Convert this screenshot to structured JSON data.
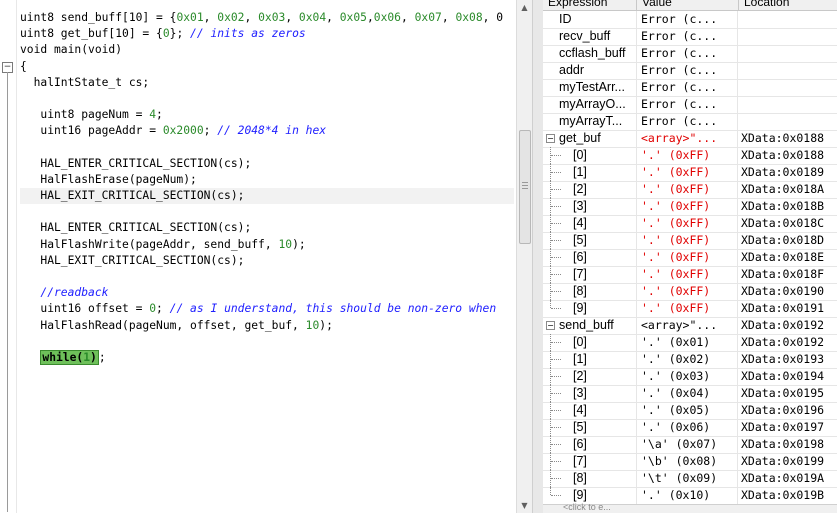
{
  "editor": {
    "fold_symbol": "−",
    "code_lines": [
      {
        "kind": "plain",
        "parts": [
          [
            "uint8 send_buff[10] = {",
            ""
          ],
          [
            "0x01",
            "num"
          ],
          [
            ", ",
            ""
          ],
          [
            "0x02",
            "num"
          ],
          [
            ", ",
            ""
          ],
          [
            "0x03",
            "num"
          ],
          [
            ", ",
            ""
          ],
          [
            "0x04",
            "num"
          ],
          [
            ", ",
            ""
          ],
          [
            "0x05",
            "num"
          ],
          [
            ",",
            ""
          ],
          [
            "0x06",
            "num"
          ],
          [
            ", ",
            ""
          ],
          [
            "0x07",
            "num"
          ],
          [
            ", ",
            ""
          ],
          [
            "0x08",
            "num"
          ],
          [
            ", 0",
            ""
          ]
        ]
      },
      {
        "kind": "plain",
        "parts": [
          [
            "uint8 get_buf[10] = {",
            ""
          ],
          [
            "0",
            "num"
          ],
          [
            "}; ",
            ""
          ],
          [
            "// inits as zeros",
            "cmt"
          ]
        ]
      },
      {
        "kind": "plain",
        "parts": [
          [
            "void main(void)",
            ""
          ]
        ]
      },
      {
        "kind": "plain",
        "parts": [
          [
            "{",
            ""
          ]
        ]
      },
      {
        "kind": "plain",
        "parts": [
          [
            "  halIntState_t cs;",
            ""
          ]
        ]
      },
      {
        "kind": "plain",
        "parts": [
          [
            "",
            ""
          ]
        ]
      },
      {
        "kind": "plain",
        "parts": [
          [
            "   uint8 pageNum = ",
            ""
          ],
          [
            "4",
            "num"
          ],
          [
            ";",
            ""
          ]
        ]
      },
      {
        "kind": "plain",
        "parts": [
          [
            "   uint16 pageAddr = ",
            ""
          ],
          [
            "0x2000",
            "num"
          ],
          [
            "; ",
            ""
          ],
          [
            "// 2048*4 in hex",
            "cmt"
          ]
        ]
      },
      {
        "kind": "plain",
        "parts": [
          [
            "",
            ""
          ]
        ]
      },
      {
        "kind": "plain",
        "parts": [
          [
            "   HAL_ENTER_CRITICAL_SECTION(cs);",
            ""
          ]
        ]
      },
      {
        "kind": "plain",
        "parts": [
          [
            "   HalFlashErase(pageNum);",
            ""
          ]
        ]
      },
      {
        "kind": "hl",
        "parts": [
          [
            "   HAL_EXIT_CRITICAL_SECTION(cs);",
            ""
          ]
        ]
      },
      {
        "kind": "plain",
        "parts": [
          [
            "",
            ""
          ]
        ]
      },
      {
        "kind": "plain",
        "parts": [
          [
            "   HAL_ENTER_CRITICAL_SECTION(cs);",
            ""
          ]
        ]
      },
      {
        "kind": "plain",
        "parts": [
          [
            "   HalFlashWrite(pageAddr, send_buff, ",
            ""
          ],
          [
            "10",
            "num"
          ],
          [
            ");",
            ""
          ]
        ]
      },
      {
        "kind": "plain",
        "parts": [
          [
            "   HAL_EXIT_CRITICAL_SECTION(cs);",
            ""
          ]
        ]
      },
      {
        "kind": "plain",
        "parts": [
          [
            "",
            ""
          ]
        ]
      },
      {
        "kind": "plain",
        "parts": [
          [
            "   ",
            ""
          ],
          [
            "//readback",
            "cmt"
          ]
        ]
      },
      {
        "kind": "plain",
        "parts": [
          [
            "   uint16 offset = ",
            ""
          ],
          [
            "0",
            "num"
          ],
          [
            "; ",
            ""
          ],
          [
            "// as I understand, this should be non-zero when",
            "cmt"
          ]
        ]
      },
      {
        "kind": "plain",
        "parts": [
          [
            "   HalFlashRead(pageNum, offset, get_buf, ",
            ""
          ],
          [
            "10",
            "num"
          ],
          [
            ");",
            ""
          ]
        ]
      },
      {
        "kind": "plain",
        "parts": [
          [
            "",
            ""
          ]
        ]
      },
      {
        "kind": "while",
        "parts": [
          [
            "   ",
            ""
          ],
          [
            "while(",
            "wb"
          ],
          [
            "1",
            "wbnum"
          ],
          [
            ")",
            "wb"
          ],
          [
            ";",
            ""
          ]
        ]
      }
    ]
  },
  "scrollbar": {
    "up_arrow": "▲",
    "down_arrow": "▼"
  },
  "watch": {
    "columns": [
      "Expression",
      "Value",
      "Location"
    ],
    "rows": [
      {
        "expr": "ID",
        "value": "Error (c...",
        "loc": "",
        "level": 0,
        "toggle": "",
        "red": false
      },
      {
        "expr": "recv_buff",
        "value": "Error (c...",
        "loc": "",
        "level": 0,
        "toggle": "",
        "red": false
      },
      {
        "expr": "ccflash_buff",
        "value": "Error (c...",
        "loc": "",
        "level": 0,
        "toggle": "",
        "red": false
      },
      {
        "expr": "addr",
        "value": "Error (c...",
        "loc": "",
        "level": 0,
        "toggle": "",
        "red": false
      },
      {
        "expr": "myTestArr...",
        "value": "Error (c...",
        "loc": "",
        "level": 0,
        "toggle": "",
        "red": false
      },
      {
        "expr": "myArrayO...",
        "value": "Error (c...",
        "loc": "",
        "level": 0,
        "toggle": "",
        "red": false
      },
      {
        "expr": "myArrayT...",
        "value": "Error (c...",
        "loc": "",
        "level": 0,
        "toggle": "",
        "red": false
      },
      {
        "expr": "get_buf",
        "value": "<array>\"...",
        "loc": "XData:0x0188",
        "level": 0,
        "toggle": "−",
        "red": true
      },
      {
        "expr": "[0]",
        "value": "'.' (0xFF)",
        "loc": "XData:0x0188",
        "level": 1,
        "toggle": "",
        "red": true
      },
      {
        "expr": "[1]",
        "value": "'.' (0xFF)",
        "loc": "XData:0x0189",
        "level": 1,
        "toggle": "",
        "red": true
      },
      {
        "expr": "[2]",
        "value": "'.' (0xFF)",
        "loc": "XData:0x018A",
        "level": 1,
        "toggle": "",
        "red": true
      },
      {
        "expr": "[3]",
        "value": "'.' (0xFF)",
        "loc": "XData:0x018B",
        "level": 1,
        "toggle": "",
        "red": true
      },
      {
        "expr": "[4]",
        "value": "'.' (0xFF)",
        "loc": "XData:0x018C",
        "level": 1,
        "toggle": "",
        "red": true
      },
      {
        "expr": "[5]",
        "value": "'.' (0xFF)",
        "loc": "XData:0x018D",
        "level": 1,
        "toggle": "",
        "red": true
      },
      {
        "expr": "[6]",
        "value": "'.' (0xFF)",
        "loc": "XData:0x018E",
        "level": 1,
        "toggle": "",
        "red": true
      },
      {
        "expr": "[7]",
        "value": "'.' (0xFF)",
        "loc": "XData:0x018F",
        "level": 1,
        "toggle": "",
        "red": true
      },
      {
        "expr": "[8]",
        "value": "'.' (0xFF)",
        "loc": "XData:0x0190",
        "level": 1,
        "toggle": "",
        "red": true
      },
      {
        "expr": "[9]",
        "value": "'.' (0xFF)",
        "loc": "XData:0x0191",
        "level": 1,
        "toggle": "",
        "red": true
      },
      {
        "expr": "send_buff",
        "value": "<array>\"...",
        "loc": "XData:0x0192",
        "level": 0,
        "toggle": "−",
        "red": false
      },
      {
        "expr": "[0]",
        "value": "'.' (0x01)",
        "loc": "XData:0x0192",
        "level": 1,
        "toggle": "",
        "red": false
      },
      {
        "expr": "[1]",
        "value": "'.' (0x02)",
        "loc": "XData:0x0193",
        "level": 1,
        "toggle": "",
        "red": false
      },
      {
        "expr": "[2]",
        "value": "'.' (0x03)",
        "loc": "XData:0x0194",
        "level": 1,
        "toggle": "",
        "red": false
      },
      {
        "expr": "[3]",
        "value": "'.' (0x04)",
        "loc": "XData:0x0195",
        "level": 1,
        "toggle": "",
        "red": false
      },
      {
        "expr": "[4]",
        "value": "'.' (0x05)",
        "loc": "XData:0x0196",
        "level": 1,
        "toggle": "",
        "red": false
      },
      {
        "expr": "[5]",
        "value": "'.' (0x06)",
        "loc": "XData:0x0197",
        "level": 1,
        "toggle": "",
        "red": false
      },
      {
        "expr": "[6]",
        "value": "'\\a' (0x07)",
        "loc": "XData:0x0198",
        "level": 1,
        "toggle": "",
        "red": false
      },
      {
        "expr": "[7]",
        "value": "'\\b' (0x08)",
        "loc": "XData:0x0199",
        "level": 1,
        "toggle": "",
        "red": false
      },
      {
        "expr": "[8]",
        "value": "'\\t' (0x09)",
        "loc": "XData:0x019A",
        "level": 1,
        "toggle": "",
        "red": false
      },
      {
        "expr": "[9]",
        "value": "'.' (0x10)",
        "loc": "XData:0x019B",
        "level": 1,
        "toggle": "",
        "red": false
      }
    ],
    "footer": "<click to e..."
  },
  "colors": {
    "number": "#2a8a2a",
    "comment": "#2020ff",
    "error_red": "#e00000",
    "while_highlight": "#6ec05a"
  }
}
